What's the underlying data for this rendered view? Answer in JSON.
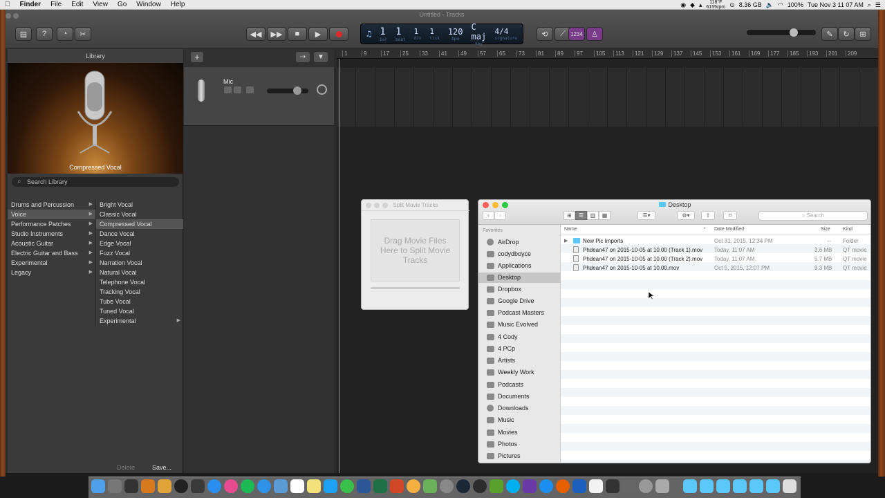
{
  "menubar": {
    "app": "Finder",
    "items": [
      "File",
      "Edit",
      "View",
      "Go",
      "Window",
      "Help"
    ],
    "window_title": "Untitled - Tracks",
    "status": {
      "temp": "118°F",
      "fan": "6155rpm",
      "storage": "8.36 GB",
      "battery": "100%",
      "datetime": "Tue Nov 3  11 07 AM"
    }
  },
  "lcd": {
    "bar": "1",
    "beat": "1",
    "div": "1",
    "tick": "1",
    "tempo": "120",
    "key": "C maj",
    "signature": "4/4",
    "labels": {
      "bar": "bar",
      "beat": "beat",
      "div": "div",
      "tick": "tick",
      "tempo": "bpm",
      "key": "key",
      "signature": "signature"
    },
    "count_in": "1234"
  },
  "library": {
    "title": "Library",
    "preset_name": "Compressed Vocal",
    "search_placeholder": "Search Library",
    "categories": [
      "Drums and Percussion",
      "Voice",
      "Performance Patches",
      "Studio Instruments",
      "Acoustic Guitar",
      "Electric Guitar and Bass",
      "Experimental",
      "Legacy"
    ],
    "selected_category": "Voice",
    "patches": [
      "Bright Vocal",
      "Classic Vocal",
      "Compressed Vocal",
      "Dance Vocal",
      "Edge Vocal",
      "Fuzz Vocal",
      "Narration Vocal",
      "Natural Vocal",
      "Telephone Vocal",
      "Tracking Vocal",
      "Tube Vocal",
      "Tuned Vocal",
      "Experimental"
    ],
    "selected_patch": "Compressed Vocal",
    "delete_label": "Delete",
    "save_label": "Save..."
  },
  "track": {
    "name": "Mic",
    "add_label": "+"
  },
  "ruler": {
    "marks": [
      "1",
      "9",
      "17",
      "25",
      "33",
      "41",
      "49",
      "57",
      "65",
      "73",
      "81",
      "89",
      "97",
      "105",
      "113",
      "121",
      "129",
      "137",
      "145",
      "153",
      "161",
      "169",
      "177",
      "185",
      "193",
      "201",
      "209"
    ]
  },
  "split_movie": {
    "title": "Split Movie Tracks",
    "drop_text": "Drag Movie Files Here to Split Movie Tracks"
  },
  "finder": {
    "title": "Desktop",
    "search_placeholder": "Search",
    "sidebar_header": "Favorites",
    "sidebar": [
      "AirDrop",
      "codydboyce",
      "Applications",
      "Desktop",
      "Dropbox",
      "Google Drive",
      "Podcast Masters",
      "Music Evolved",
      "4 Cody",
      "4 PCp",
      "Artists",
      "Weekly Work",
      "Podcasts",
      "Documents",
      "Downloads",
      "Music",
      "Movies",
      "Photos",
      "Pictures"
    ],
    "selected": "Desktop",
    "columns": {
      "name": "Name",
      "date": "Date Modified",
      "size": "Size",
      "kind": "Kind"
    },
    "files": [
      {
        "name": "New Pic Imports",
        "date": "Oct 31, 2015, 12:34 PM",
        "size": "--",
        "kind": "Folder",
        "type": "folder"
      },
      {
        "name": "Phdean47 on 2015-10-05 at 10.00 (Track 1).mov",
        "date": "Today, 11:07 AM",
        "size": "3.6 MB",
        "kind": "QT movie",
        "type": "movie"
      },
      {
        "name": "Phdean47 on 2015-10-05 at 10.00 (Track 2).mov",
        "date": "Today, 11:07 AM",
        "size": "5.7 MB",
        "kind": "QT movie",
        "type": "movie"
      },
      {
        "name": "Phdean47 on 2015-10-05 at 10.00.mov",
        "date": "Oct 5, 2015, 12:07 PM",
        "size": "9.3 MB",
        "kind": "QT movie",
        "type": "movie"
      }
    ]
  },
  "colors": {
    "accent": "#3478f6",
    "record": "#e0282e",
    "folder": "#5ac8fa",
    "lcd_text": "#cfe1ff"
  },
  "dock": {
    "icons": [
      "finder-icon",
      "launchpad-icon",
      "safari-icon",
      "photos-icon",
      "itunes-icon",
      "spotify-icon",
      "calendar-icon",
      "messages-icon",
      "twitter-icon",
      "steam-icon",
      "trash-icon"
    ]
  }
}
